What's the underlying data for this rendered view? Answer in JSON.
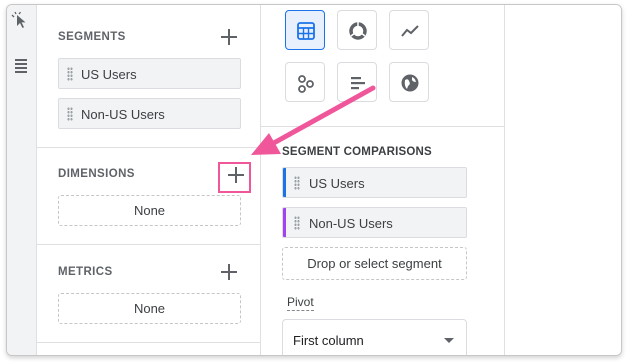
{
  "left_panel": {
    "segments": {
      "title": "SEGMENTS",
      "items": [
        {
          "label": "US Users"
        },
        {
          "label": "Non-US Users"
        }
      ]
    },
    "dimensions": {
      "title": "DIMENSIONS",
      "empty_label": "None"
    },
    "metrics": {
      "title": "METRICS",
      "empty_label": "None"
    }
  },
  "visualization": {
    "options": [
      {
        "icon": "table-icon",
        "selected": true
      },
      {
        "icon": "donut-chart-icon",
        "selected": false
      },
      {
        "icon": "line-chart-icon",
        "selected": false
      },
      {
        "icon": "scatter-plot-icon",
        "selected": false
      },
      {
        "icon": "bar-chart-icon",
        "selected": false
      },
      {
        "icon": "geo-map-icon",
        "selected": false
      }
    ]
  },
  "segment_comparisons": {
    "title": "SEGMENT COMPARISONS",
    "items": [
      {
        "label": "US Users",
        "color": "#1a73e8"
      },
      {
        "label": "Non-US Users",
        "color": "#a142f4"
      }
    ],
    "drop_label": "Drop or select segment"
  },
  "pivot": {
    "label": "Pivot",
    "selected_value": "First column"
  },
  "annotation": {
    "color": "#f0569a"
  }
}
